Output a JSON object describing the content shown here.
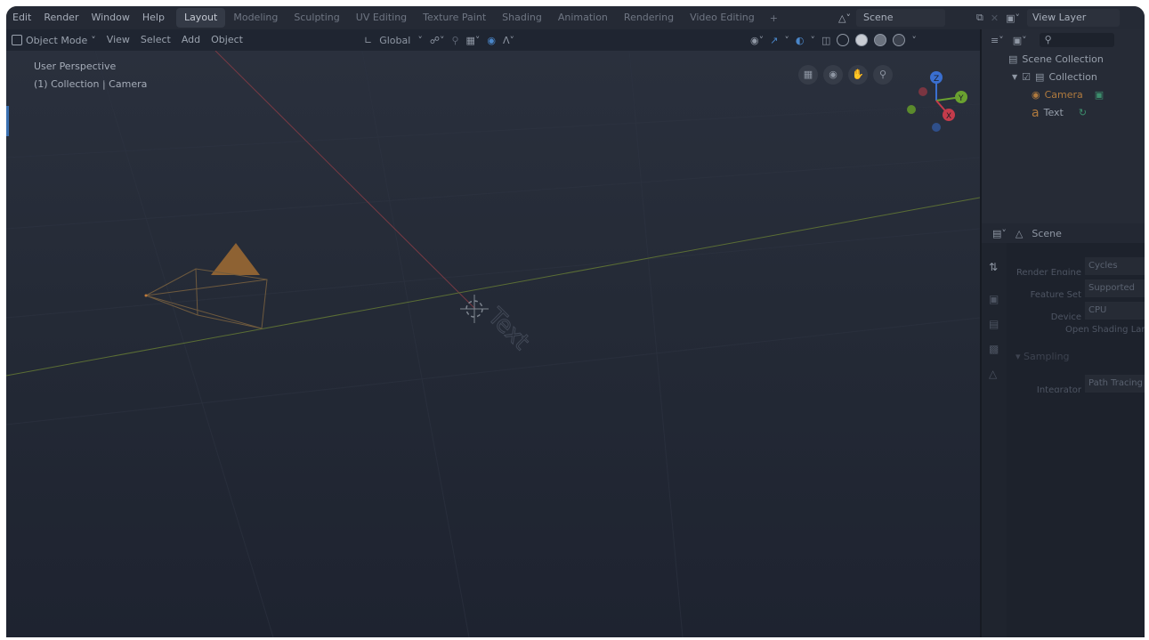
{
  "menu": [
    "Edit",
    "Render",
    "Window",
    "Help"
  ],
  "workspace_tabs": [
    {
      "label": "Layout",
      "active": true
    },
    {
      "label": "Modeling"
    },
    {
      "label": "Sculpting"
    },
    {
      "label": "UV Editing"
    },
    {
      "label": "Texture Paint"
    },
    {
      "label": "Shading"
    },
    {
      "label": "Animation"
    },
    {
      "label": "Rendering"
    },
    {
      "label": "Video Editing"
    }
  ],
  "add_tab_glyph": "+",
  "scene_selector": {
    "value": "Scene",
    "icon": "scene-icon"
  },
  "view_layer_selector": {
    "value": "View Layer",
    "icon": "view-layer-icon"
  },
  "viewport_header": {
    "mode": "Object Mode",
    "menus": [
      "View",
      "Select",
      "Add",
      "Object"
    ],
    "orientation": "Global"
  },
  "viewport": {
    "perspective_label": "User Perspective",
    "context_label": "(1) Collection | Camera",
    "nav_icons": [
      "grid-view-icon",
      "camera-view-icon",
      "pan-hand-icon",
      "zoom-icon"
    ],
    "gizmo": {
      "z": "Z",
      "y": "Y",
      "x": "X"
    },
    "scene_text_object": "Text"
  },
  "outliner": {
    "root": "Scene Collection",
    "collection": "Collection",
    "items": [
      {
        "label": "Camera",
        "icon": "camera-object-icon",
        "selected": true
      },
      {
        "label": "Text",
        "icon": "text-object-icon"
      }
    ]
  },
  "properties": {
    "scene_label": "Scene",
    "rows": [
      {
        "label": "Render Engine",
        "value": "Cycles"
      },
      {
        "label": "Feature Set",
        "value": "Supported"
      },
      {
        "label": "Device",
        "value": "CPU"
      }
    ],
    "osl_label": "Open Shading Language",
    "section": "Sampling",
    "integrator_label": "Integrator",
    "integrator_value": "Path Tracing"
  },
  "colors": {
    "camera_orange": "#b07a3e",
    "axis_red": "#c43b4b",
    "axis_green": "#6aa130",
    "axis_blue": "#3a6fd0"
  }
}
